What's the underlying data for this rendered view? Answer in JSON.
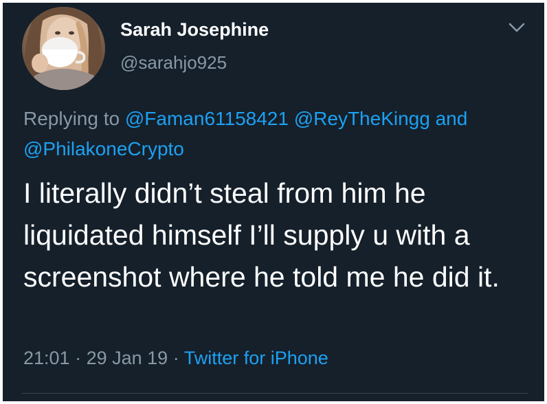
{
  "tweet": {
    "author": {
      "name": "Sarah Josephine",
      "handle": "@sarahjo925"
    },
    "replying_prefix": "Replying to ",
    "mentions": [
      "@Faman61158421",
      "@ReyTheKingg",
      "@PhilakoneCrypto"
    ],
    "mention_joiner": " and",
    "text": "I literally didn’t steal from him he liquidated himself I’ll supply u with a screenshot where he told me he did it.",
    "time": "21:01",
    "date": "29 Jan 19",
    "separator": " · ",
    "source": "Twitter for iPhone"
  },
  "colors": {
    "background": "#15202b",
    "text": "#ffffff",
    "secondary": "#8899a6",
    "accent": "#1da1f2"
  },
  "icons": {
    "menu": "chevron-down-icon",
    "avatar": "profile-photo"
  }
}
